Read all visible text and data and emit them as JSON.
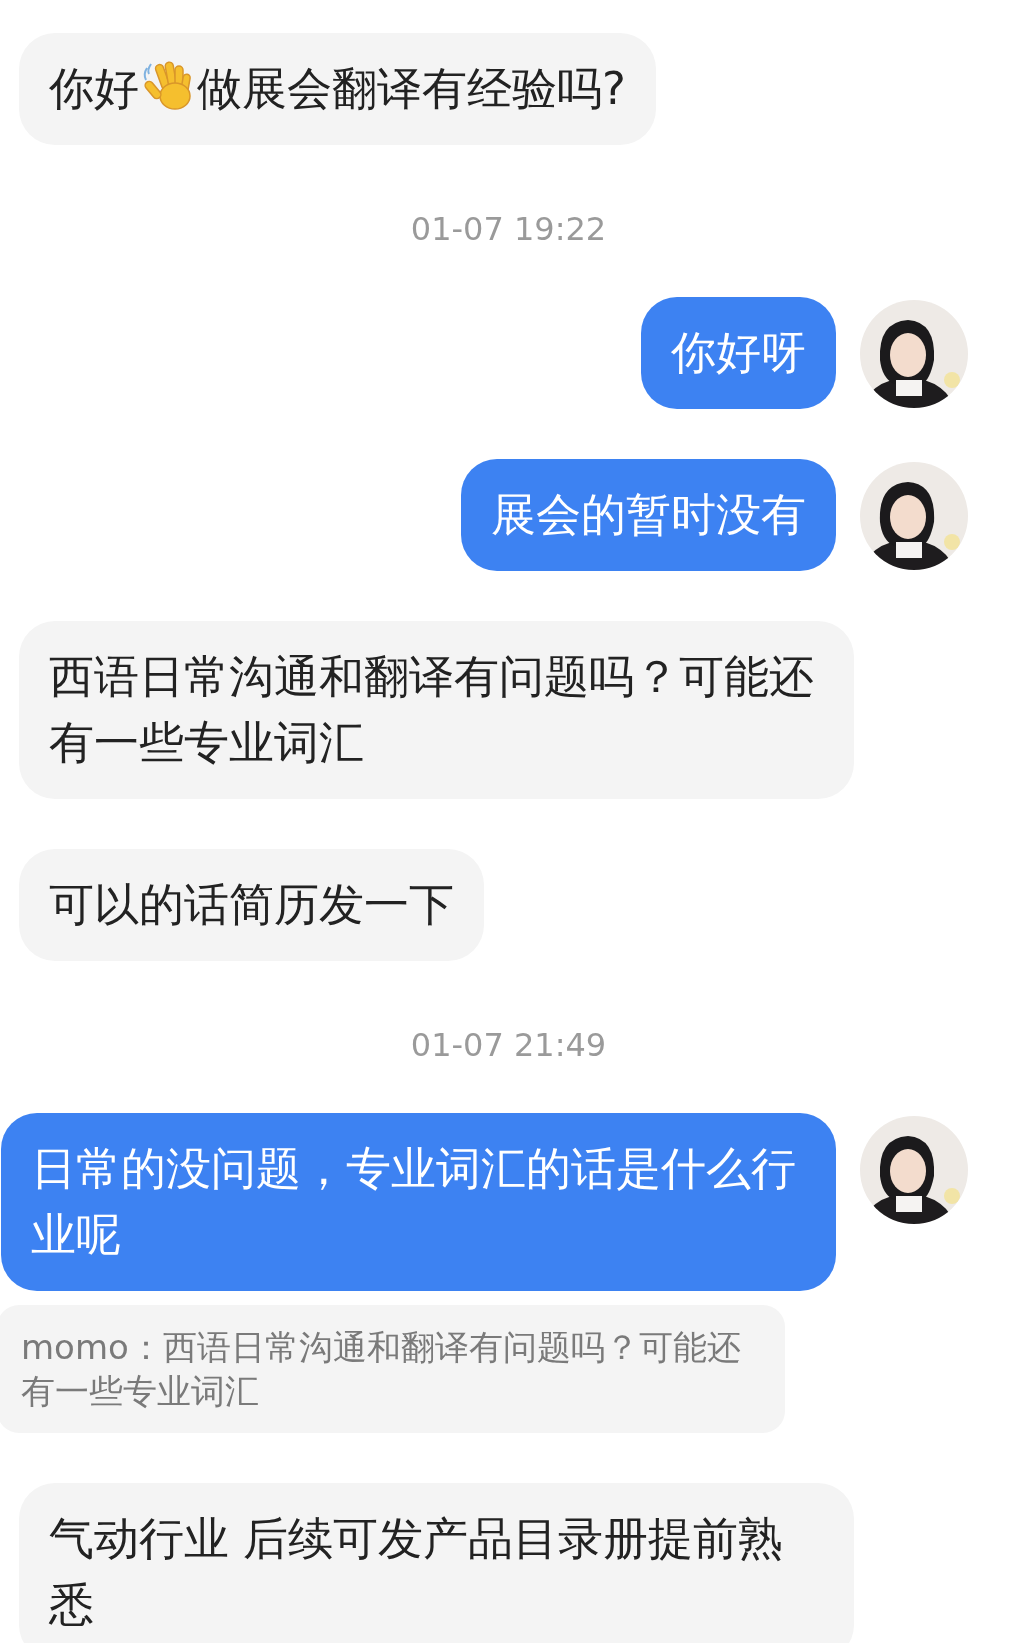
{
  "messages": [
    {
      "kind": "received",
      "parts": [
        {
          "kind": "text",
          "text": "你好"
        },
        {
          "kind": "wave"
        },
        {
          "kind": "text",
          "text": "做展会翻译有经验吗?"
        }
      ]
    },
    {
      "kind": "timestamp",
      "text": "01-07 19:22"
    },
    {
      "kind": "sent",
      "text": "你好呀"
    },
    {
      "kind": "sent",
      "text": "展会的暂时没有"
    },
    {
      "kind": "received",
      "text": "西语日常沟通和翻译有问题吗？可能还有一些专业词汇"
    },
    {
      "kind": "received",
      "text": "可以的话简历发一下"
    },
    {
      "kind": "timestamp",
      "text": "01-07 21:49"
    },
    {
      "kind": "sent",
      "text": "日常的没问题，专业词汇的话是什么行业呢",
      "quote": "momo：西语日常沟通和翻译有问题吗？可能还有一些专业词汇"
    },
    {
      "kind": "received",
      "text": "气动行业 后续可发产品目录册提前熟悉"
    }
  ]
}
